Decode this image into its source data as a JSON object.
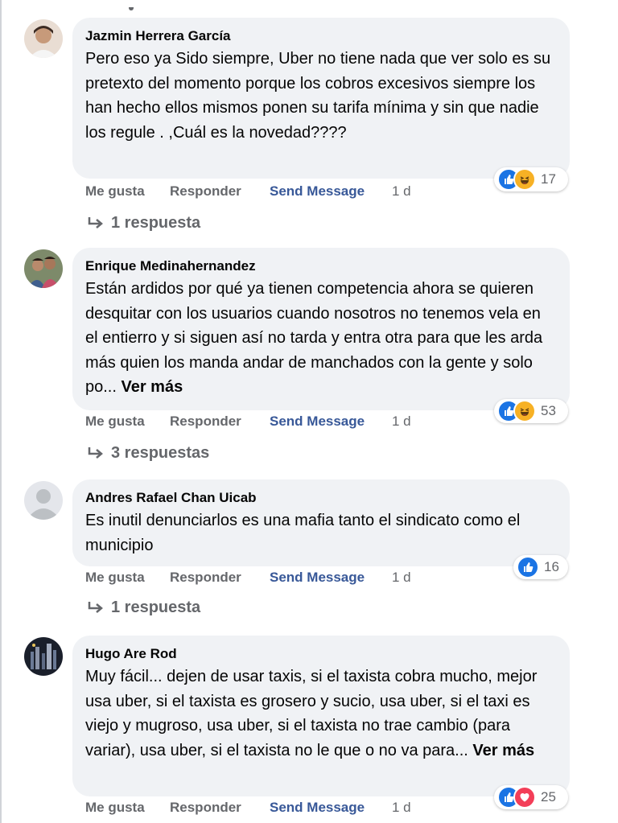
{
  "action_labels": {
    "like": "Me gusta",
    "reply": "Responder",
    "send_message": "Send Message"
  },
  "colors": {
    "bubble_bg": "#f0f2f5",
    "action_text": "#65676b",
    "send_message_link": "#385898",
    "like_reaction": "#1b74e4",
    "haha_reaction": "#f7b125",
    "love_reaction": "#f33e58"
  },
  "comments": [
    {
      "author": "Jazmin Herrera García",
      "text": "Pero eso ya Sido siempre, Uber no tiene nada que ver solo es su pretexto del momento porque los cobros excesivos siempre los han hecho ellos mismos ponen su tarifa mínima y sin que nadie los regule . ,Cuál es la novedad????",
      "see_more": "",
      "reactions": [
        "like-icon",
        "haha-icon"
      ],
      "reaction_count": "17",
      "time": "1 d",
      "replies_label": "1 respuesta"
    },
    {
      "author": "Enrique Medinahernandez",
      "text": "Están ardidos por qué ya tienen competencia ahora se quieren desquitar con los usuarios cuando nosotros no tenemos vela en el entierro y si siguen así no tarda y entra otra para que les arda más quien los manda andar de manchados con la gente y solo po...",
      "see_more": "Ver más",
      "reactions": [
        "like-icon",
        "haha-icon"
      ],
      "reaction_count": "53",
      "time": "1 d",
      "replies_label": "3 respuestas"
    },
    {
      "author": "Andres Rafael Chan Uicab",
      "text": "Es inutil denunciarlos es una mafia tanto el sindicato como el municipio",
      "see_more": "",
      "reactions": [
        "like-icon"
      ],
      "reaction_count": "16",
      "time": "1 d",
      "replies_label": "1 respuesta"
    },
    {
      "author": "Hugo Are Rod",
      "text": "Muy fácil... dejen de usar taxis, si el taxista cobra mucho, mejor usa uber, si el taxista es grosero y sucio, usa uber, si el taxi es viejo y mugroso, usa uber, si el taxista no trae cambio (para variar), usa uber, si el taxista no le que o no va para...",
      "see_more": "Ver más",
      "reactions": [
        "like-icon",
        "love-icon"
      ],
      "reaction_count": "25",
      "time": "1 d",
      "replies_label": ""
    }
  ]
}
